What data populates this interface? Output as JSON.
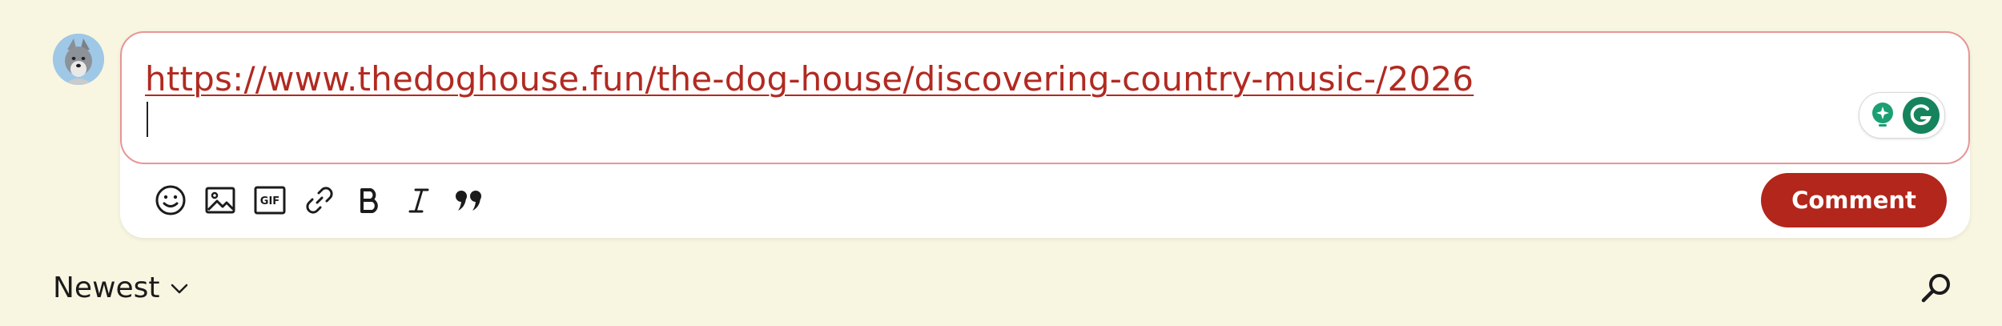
{
  "composer": {
    "link_text": "https://www.thedoghouse.fun/the-dog-house/discovering-country-music-/2026",
    "toolbar": {
      "emoji_icon": "smile-icon",
      "image_icon": "image-icon",
      "gif_label": "GIF",
      "link_icon": "link-icon",
      "bold_icon": "bold-icon",
      "italic_icon": "italic-icon",
      "quote_icon": "quote-icon"
    },
    "comment_label": "Comment"
  },
  "sort": {
    "label": "Newest"
  },
  "colors": {
    "background": "#f8f6e1",
    "accent": "#b2261b",
    "editor_border": "#e79595",
    "grammarly_green": "#15845c"
  }
}
